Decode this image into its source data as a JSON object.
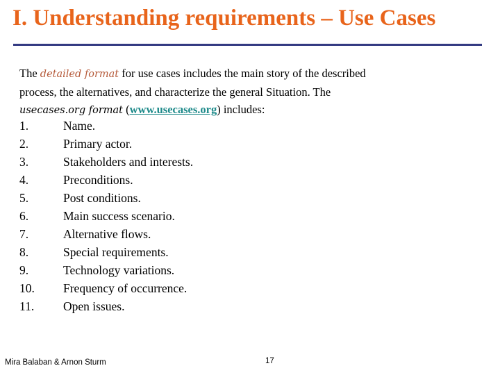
{
  "slide": {
    "title": "I. Understanding requirements – Use Cases",
    "colors": {
      "title": "#e8641b",
      "rule": "#333a82",
      "link": "#1e8a8a",
      "emphasis": "#b55a3a"
    },
    "intro": {
      "part1": "The ",
      "em1": "detailed format",
      "part2": " for use cases includes the main story of the described process, the alternatives, and characterize the general Situation. The ",
      "em2": "usecases.org format",
      "part3": " (",
      "link": "www.usecases.org",
      "part4": ") includes:"
    },
    "items": [
      {
        "num": "1.",
        "text": "Name."
      },
      {
        "num": "2.",
        "text": "Primary actor."
      },
      {
        "num": "3.",
        "text": "Stakeholders and interests."
      },
      {
        "num": "4.",
        "text": "Preconditions."
      },
      {
        "num": "5.",
        "text": "Post conditions."
      },
      {
        "num": "6.",
        "text": "Main success scenario."
      },
      {
        "num": "7.",
        "text": "Alternative flows."
      },
      {
        "num": "8.",
        "text": "Special requirements."
      },
      {
        "num": "9.",
        "text": "Technology variations."
      },
      {
        "num": "10.",
        "text": "Frequency of occurrence."
      },
      {
        "num": "11.",
        "text": "Open issues."
      }
    ],
    "footer": {
      "authors": "Mira Balaban  &  Arnon Sturm",
      "page": "17"
    }
  }
}
